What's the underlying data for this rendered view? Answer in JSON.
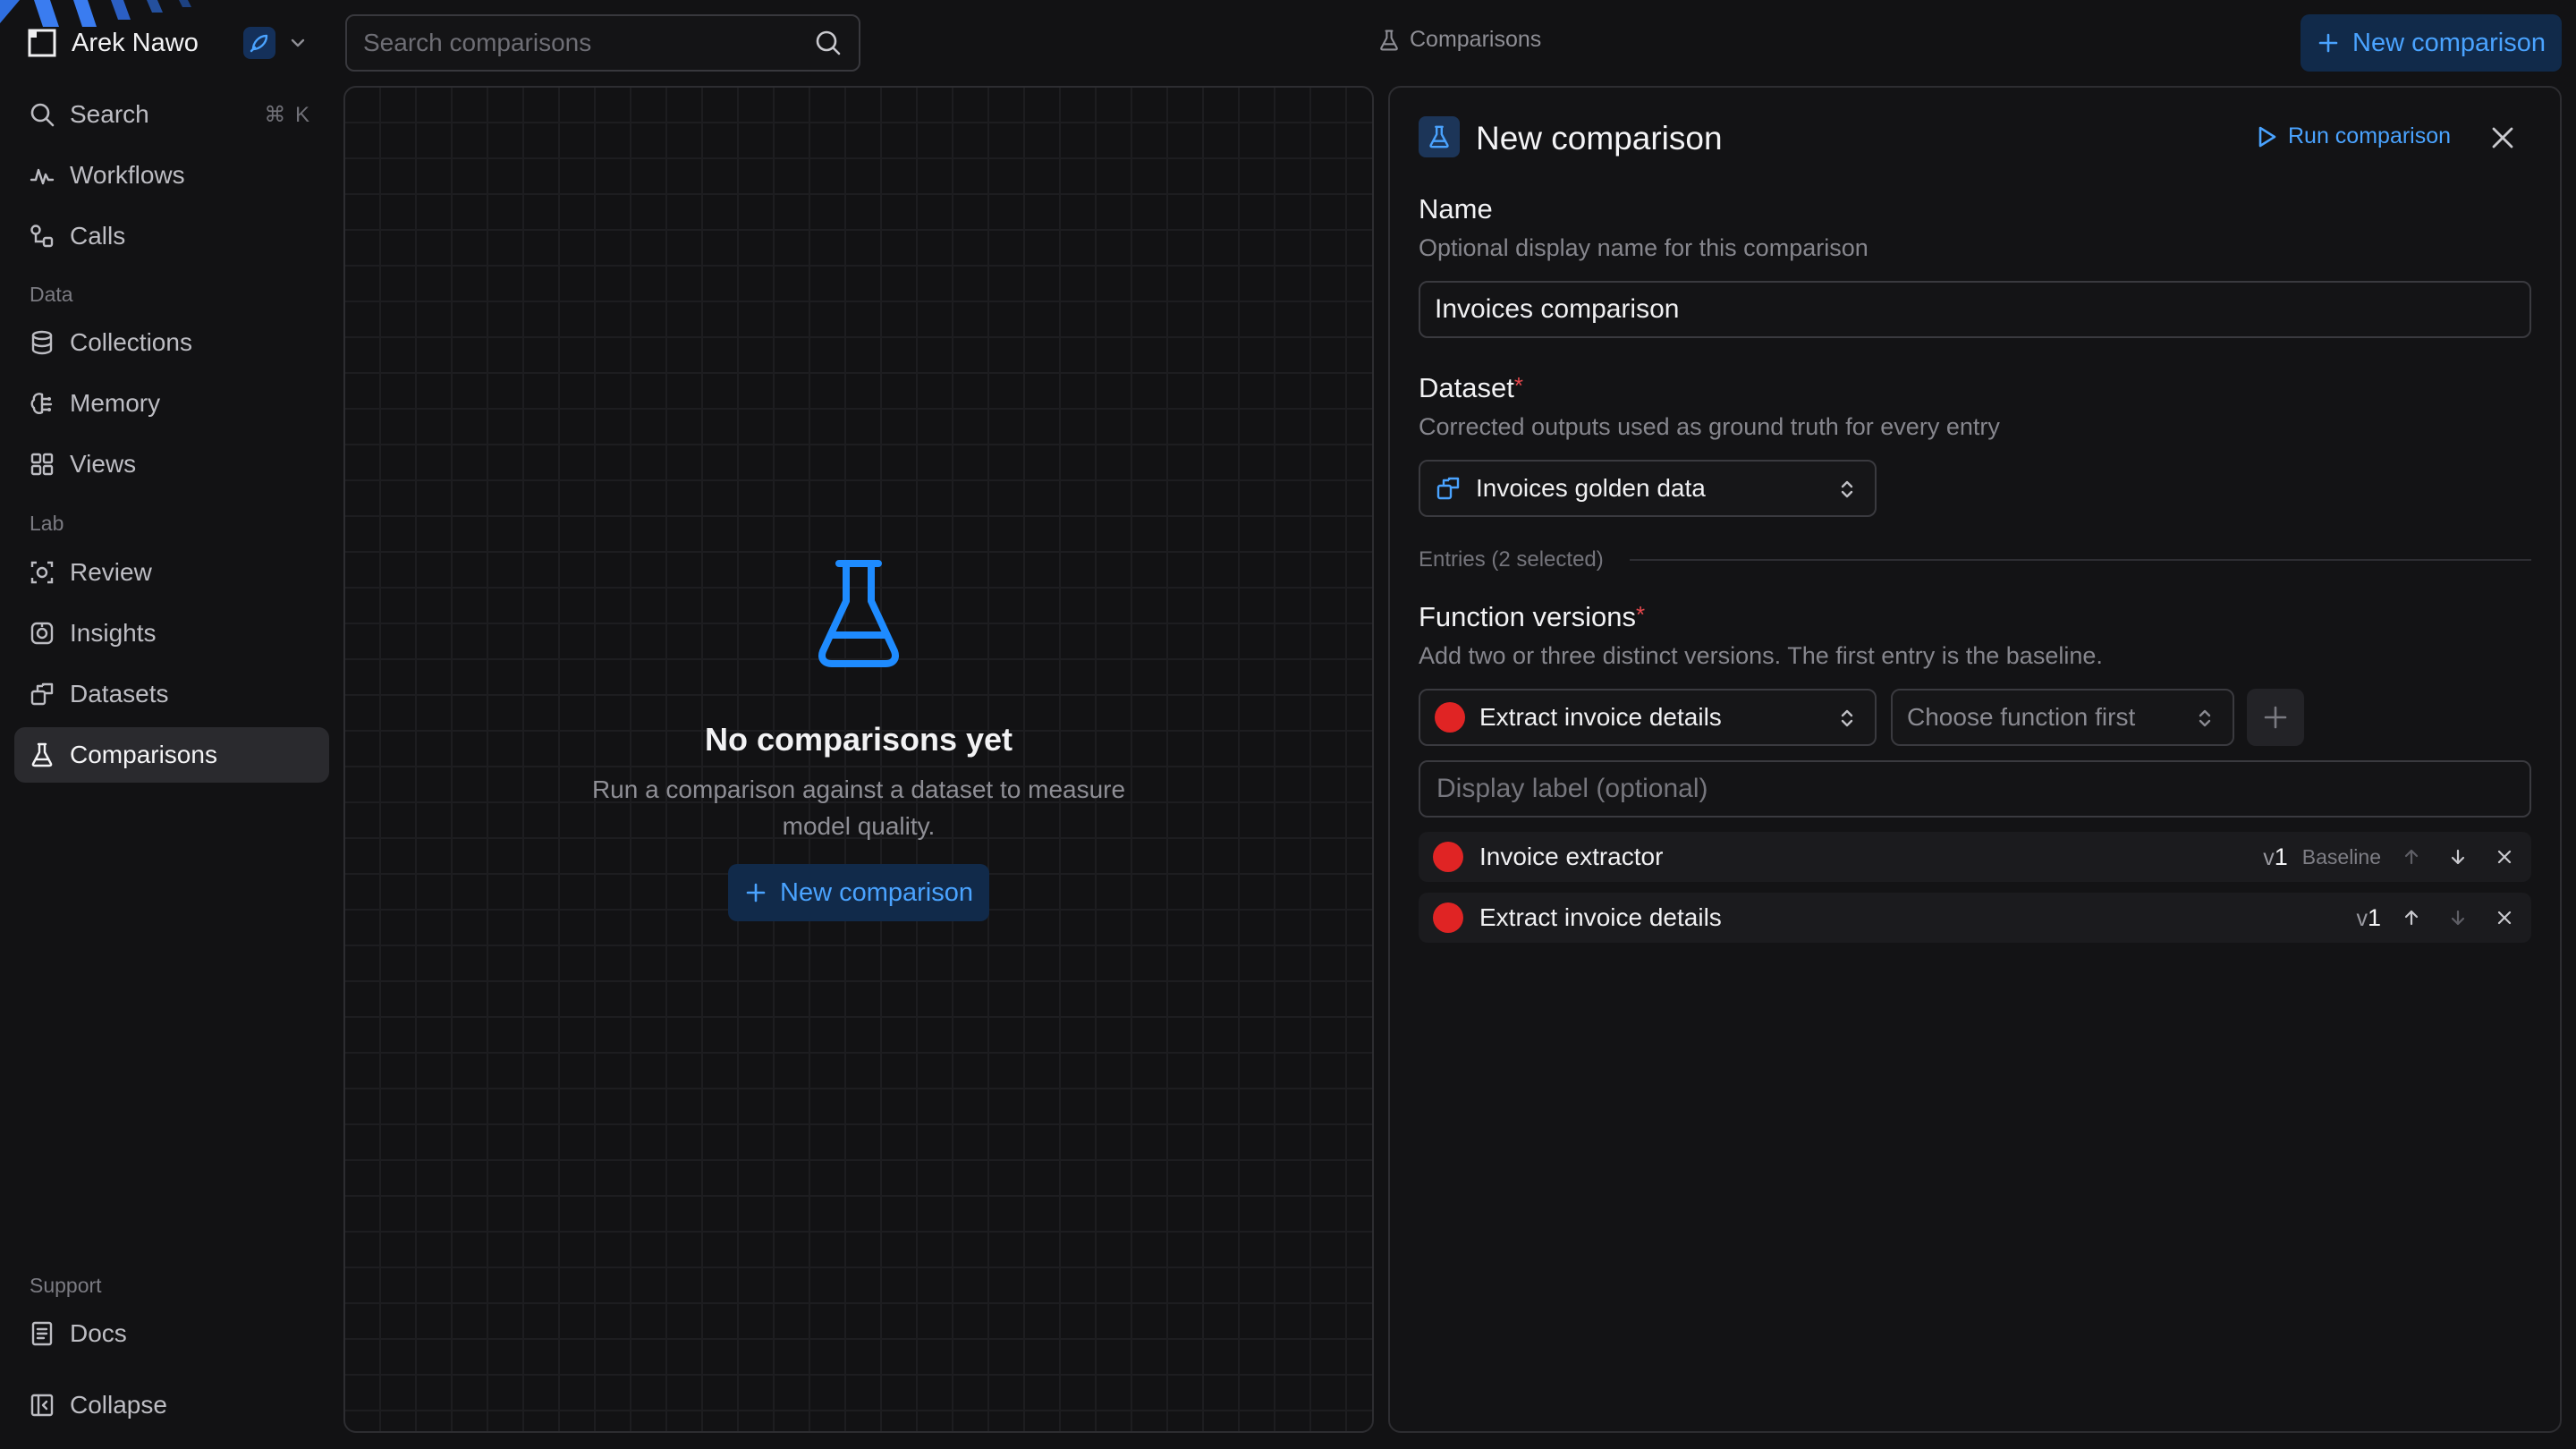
{
  "workspace": {
    "name": "Arek Nawo"
  },
  "search": {
    "placeholder": "Search comparisons"
  },
  "breadcrumb": {
    "label": "Comparisons"
  },
  "header": {
    "new_button": "New comparison"
  },
  "sidebar": {
    "items": [
      {
        "label": "Search",
        "shortcut": "⌘ K"
      },
      {
        "label": "Workflows"
      },
      {
        "label": "Calls"
      },
      {
        "label": "Collections"
      },
      {
        "label": "Memory"
      },
      {
        "label": "Views"
      },
      {
        "label": "Review"
      },
      {
        "label": "Insights"
      },
      {
        "label": "Datasets"
      },
      {
        "label": "Comparisons",
        "active": true
      }
    ],
    "sections": {
      "data": "Data",
      "lab": "Lab",
      "support": "Support"
    },
    "footer": {
      "docs": "Docs",
      "collapse": "Collapse"
    }
  },
  "empty_state": {
    "title": "No comparisons yet",
    "description": "Run a comparison against a dataset to measure model quality.",
    "button": "New comparison"
  },
  "form": {
    "title": "New comparison",
    "run_button": "Run comparison",
    "name": {
      "label": "Name",
      "hint": "Optional display name for this comparison",
      "value": "Invoices comparison"
    },
    "dataset": {
      "label": "Dataset",
      "required_mark": "*",
      "hint": "Corrected outputs used as ground truth for every entry",
      "selected": "Invoices golden data"
    },
    "entries_label": "Entries (2 selected)",
    "function_versions": {
      "label": "Function versions",
      "required_mark": "*",
      "hint": "Add two or three distinct versions. The first entry is the baseline.",
      "function_select": "Extract invoice details",
      "version_select_placeholder": "Choose function first",
      "display_label_placeholder": "Display label (optional)",
      "rows": [
        {
          "name": "Invoice extractor",
          "version_prefix": "v",
          "version_number": "1",
          "badge": "Baseline"
        },
        {
          "name": "Extract invoice details",
          "version_prefix": "v",
          "version_number": "1",
          "badge": ""
        }
      ]
    }
  },
  "colors": {
    "accent": "#4aa3ff",
    "accent_bg": "#112a4a",
    "required": "#e5484d",
    "function_dot": "#e02424",
    "background": "#121214"
  }
}
